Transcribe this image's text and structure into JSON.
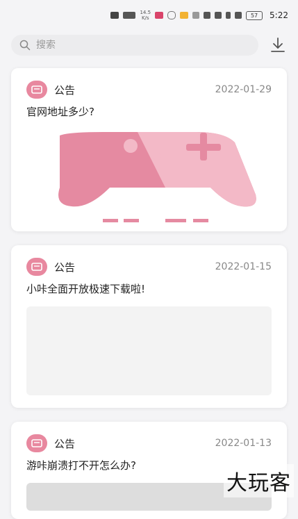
{
  "status_bar": {
    "network_speed": "14.5\nK/s",
    "battery": "57",
    "time": "5:22"
  },
  "search": {
    "placeholder": "搜索"
  },
  "cards": [
    {
      "tag": "公告",
      "date": "2022-01-29",
      "title": "官网地址多少?"
    },
    {
      "tag": "公告",
      "date": "2022-01-15",
      "title": "小咔全面开放极速下载啦!"
    },
    {
      "tag": "公告",
      "date": "2022-01-13",
      "title": "游咔崩溃打不开怎么办?"
    }
  ],
  "colors": {
    "accent": "#e8889f",
    "background": "#f4f4f6"
  },
  "watermark": "大玩客"
}
